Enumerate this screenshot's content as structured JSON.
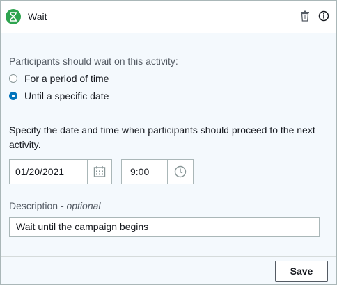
{
  "header": {
    "title": "Wait",
    "badge_icon": "hourglass-icon",
    "badge_color": "#2ea44f",
    "delete_icon": "trash-icon",
    "info_icon": "info-icon"
  },
  "wait_options": {
    "label": "Participants should wait on this activity:",
    "options": [
      {
        "label": "For a period of time",
        "selected": false
      },
      {
        "label": "Until a specific date",
        "selected": true
      }
    ]
  },
  "schedule": {
    "label": "Specify the date and time when participants should proceed to the next activity.",
    "date_value": "01/20/2021",
    "time_value": "9:00",
    "date_icon": "calendar-icon",
    "time_icon": "clock-icon"
  },
  "description": {
    "label": "Description",
    "optional_suffix": "- optional",
    "value": "Wait until the campaign begins"
  },
  "footer": {
    "save_label": "Save"
  },
  "colors": {
    "accent": "#0073bb",
    "panel_background": "#f4f9fd"
  }
}
